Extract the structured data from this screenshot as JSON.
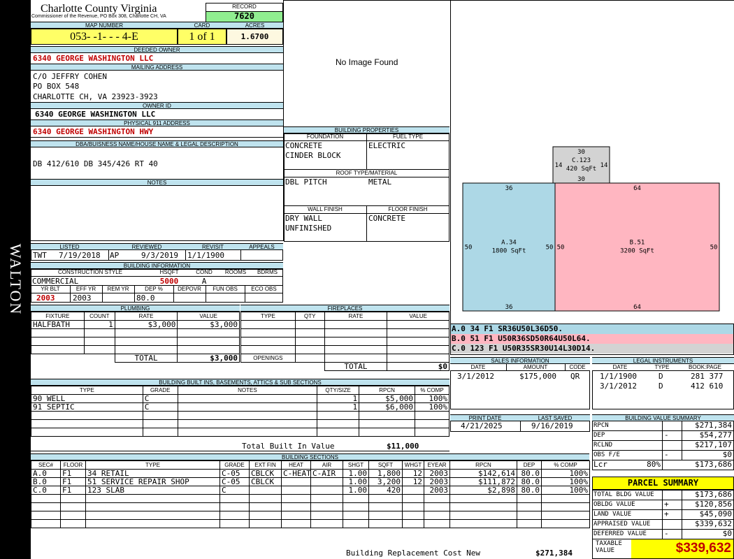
{
  "side_label": "WALTON",
  "county": {
    "name": "Charlotte County Virginia",
    "sub": "Commissioner of the Revenue, PO Box 308, Charlotte CH, VA"
  },
  "record": {
    "label": "RECORD",
    "value": "7620"
  },
  "map": {
    "label": "MAP NUMBER",
    "value": "053- -1- - - 4-E",
    "card_label": "CARD",
    "card": "1 of 1",
    "acres_label": "ACRES",
    "acres": "1.6700"
  },
  "owner": {
    "label": "DEEDED OWNER",
    "value": "6340 GEORGE WASHINGTON LLC"
  },
  "mailing": {
    "label": "MAILING ADDRESS",
    "lines": [
      "C/O JEFFRY COHEN",
      "PO BOX 548",
      "CHARLOTTE CH, VA 23923-3923"
    ]
  },
  "owner_id": {
    "label": "OWNER ID",
    "value": "6340 GEORGE WASHINGTON LLC"
  },
  "physical": {
    "label": "PHYSICAL 911 ADDRESS",
    "value": "6340 GEORGE WASHINGTON HWY"
  },
  "legal": {
    "label": "DBA/BUISNESS NAME/HOUSE NAME & LEGAL DESCRIPTION",
    "value": "DB 412/610 DB 345/426  RT 40"
  },
  "notes": {
    "label": "NOTES"
  },
  "image": {
    "text": "No Image Found"
  },
  "bp": {
    "label": "BUILDING PROPERTIES",
    "foundation_label": "FOUNDATION",
    "foundation": [
      "CONCRETE",
      "CINDER BLOCK"
    ],
    "fuel_label": "FUEL TYPE",
    "fuel": "ELECTRIC",
    "roof_label": "ROOF TYPE/MATERIAL",
    "roof_type": "DBL PITCH",
    "roof_material": "METAL",
    "wall_label": "WALL FINISH",
    "wall": [
      "DRY WALL",
      "UNFINISHED"
    ],
    "floor_label": "FLOOR FINISH",
    "floor": "CONCRETE"
  },
  "listed": {
    "listed_label": "LISTED",
    "listed_by": "TWT",
    "listed_date": "7/19/2018",
    "reviewed_label": "REVIEWED",
    "reviewed_by": "AP",
    "reviewed_date": "9/3/2019",
    "revisit_label": "REVISIT",
    "revisit": "1/1/1900",
    "appeals_label": "APPEALS"
  },
  "binfo": {
    "label": "BUILDING INFORMATION",
    "style_label": "CONSTRUCTION STYLE",
    "style": "COMMERCIAL",
    "hsqft_label": "HSQFT",
    "hsqft": "5000",
    "cond_label": "COND",
    "cond": "A",
    "rooms_label": "ROOMS",
    "bdrms_label": "BDRMS",
    "yrblt_label": "YR BLT",
    "yrblt": "2003",
    "effyr_label": "EFF YR",
    "effyr": "2003",
    "remyr_label": "REM YR",
    "dep_label": "DEP %",
    "dep": "80.0",
    "depovr_label": "DEPOVR",
    "funobs_label": "FUN OBS",
    "ecoobs_label": "ECO OBS"
  },
  "plumbing": {
    "label": "PLUMBING",
    "headers": [
      "FIXTURE",
      "COUNT",
      "RATE",
      "VALUE"
    ],
    "rows": [
      [
        "HALFBATH",
        "1",
        "$3,000",
        "$3,000"
      ]
    ],
    "total_label": "TOTAL",
    "total": "$3,000"
  },
  "fireplaces": {
    "label": "FIREPLACES",
    "headers": [
      "TYPE",
      "QTY",
      "RATE",
      "VALUE"
    ],
    "openings_label": "OPENINGS",
    "total_label": "TOTAL",
    "total": "$0"
  },
  "builtins": {
    "label": "BUILDING BUILT INS, BASEMENTS, ATTICS & SUB SECTIONS",
    "headers": [
      "TYPE",
      "GRADE",
      "NOTES",
      "QTY/SIZE",
      "RPCN",
      "% COMP"
    ],
    "rows": [
      [
        "90 WELL",
        "C",
        "",
        "1",
        "$5,000",
        "100%"
      ],
      [
        "91 SEPTIC",
        "C",
        "",
        "1",
        "$6,000",
        "100%"
      ]
    ],
    "total_label": "Total Built In Value",
    "total": "$11,000"
  },
  "sections": {
    "label": "BUILDING SECTIONS",
    "headers": [
      "SEC#",
      "FLOOR",
      "TYPE",
      "GRADE",
      "EXT FIN",
      "HEAT",
      "AIR",
      "SHGT",
      "SQFT",
      "WHGT",
      "EYEAR",
      "RPCN",
      "DEP",
      "% COMP"
    ],
    "rows": [
      [
        "A.0",
        "F1",
        "34 RETAIL",
        "C-05",
        "CBLCK",
        "C-HEAT",
        "C-AIR",
        "1.00",
        "1,800",
        "12",
        "2003",
        "$142,614",
        "80.0",
        "100%"
      ],
      [
        "B.0",
        "F1",
        "51 SERVICE REPAIR SHOP",
        "C-05",
        "CBLCK",
        "",
        "",
        "1.00",
        "3,200",
        "12",
        "2003",
        "$111,872",
        "80.0",
        "100%"
      ],
      [
        "C.0",
        "F1",
        "123 SLAB",
        "C",
        "",
        "",
        "",
        "1.00",
        "420",
        "",
        "2003",
        "$2,898",
        "80.0",
        "100%"
      ]
    ],
    "brcn_label": "Building Replacement Cost New",
    "brcn": "$271,384"
  },
  "sketch": {
    "sections": [
      {
        "id": "C.123",
        "area": "420 SqFt",
        "top": "30",
        "bottom": "30",
        "left": "14",
        "right": "14",
        "color": "#d3d3d3"
      },
      {
        "id": "A.34",
        "area": "1800 SqFt",
        "top": "36",
        "bottom": "36",
        "left": "50",
        "right": "50",
        "color": "#add8e6"
      },
      {
        "id": "B.51",
        "area": "3200 SqFt",
        "top": "64",
        "bottom": "64",
        "left": "50",
        "right": "50",
        "color": "#ffb6c1"
      }
    ]
  },
  "sketch_codes": [
    {
      "text": "A.0   34   F1   SR36U50L36D50.",
      "color": "#add8e6"
    },
    {
      "text": "B.0   51   F1   U50R36SD50R64U50L64.",
      "color": "#ffb6c1"
    },
    {
      "text": "C.0   123  F1   U50R35SR30U14L30D14.",
      "color": "#d3d3d3"
    }
  ],
  "sales": {
    "label": "SALES INFORMATION",
    "headers": [
      "DATE",
      "AMOUNT",
      "CODE"
    ],
    "rows": [
      [
        "3/1/2012",
        "$175,000",
        "QR"
      ]
    ]
  },
  "legal_instr": {
    "label": "LEGAL INSTRUMENTS",
    "headers": [
      "DATE",
      "TYPE",
      "BOOK:PAGE"
    ],
    "rows": [
      [
        "1/1/1900",
        "D",
        "281 377"
      ],
      [
        "3/1/2012",
        "D",
        "412 610"
      ]
    ]
  },
  "print": {
    "print_label": "PRINT DATE",
    "print_date": "4/21/2025",
    "saved_label": "LAST SAVED",
    "saved_date": "9/16/2019"
  },
  "bvs": {
    "label": "BUILDING VALUE SUMMARY",
    "rows": [
      [
        "RPCN",
        "",
        "$271,384"
      ],
      [
        "DEP",
        "-",
        "$54,277"
      ],
      [
        "RCLND",
        "",
        "$217,107"
      ],
      [
        "OBS F/E",
        "-",
        "$0"
      ]
    ],
    "lcr_label": "Lcr",
    "lcr_pct": "80%",
    "lcr_value": "$173,686"
  },
  "parcel": {
    "label": "PARCEL SUMMARY",
    "rows": [
      [
        "TOTAL BLDG VALUE",
        "",
        "$173,686"
      ],
      [
        "OBLDG VALUE",
        "+",
        "$120,856"
      ],
      [
        "LAND VALUE",
        "+",
        "$45,090"
      ],
      [
        "APPRAISED VALUE",
        "",
        "$339,632"
      ],
      [
        "DEFERRED VALUE",
        "-",
        "$0"
      ]
    ],
    "taxable_label": "TAXABLE VALUE",
    "taxable": "$339,632"
  }
}
